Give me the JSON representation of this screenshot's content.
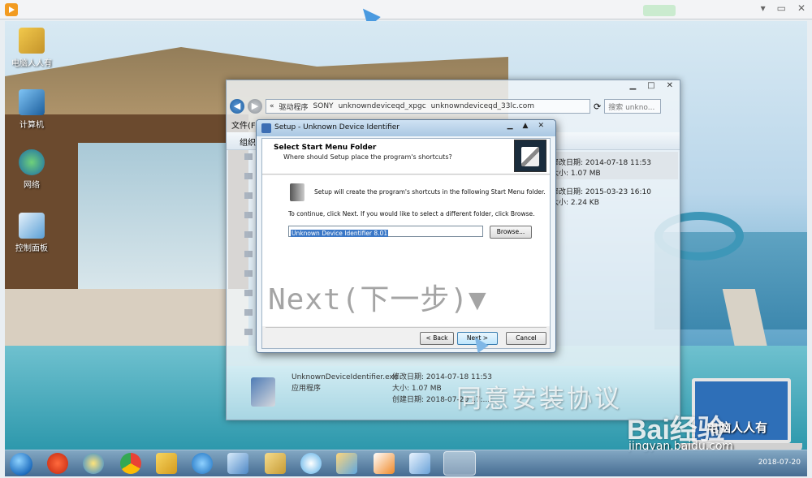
{
  "desktop": {
    "icons": [
      {
        "label": "电脑人人有"
      },
      {
        "label": "计算机"
      },
      {
        "label": "网络"
      },
      {
        "label": "控制面板"
      }
    ]
  },
  "explorer": {
    "window_controls": [
      "▁",
      "□",
      "✕"
    ],
    "breadcrumb": [
      "«",
      "驱动程序",
      "SONY",
      "unknowndeviceqd_xpgc",
      "unknowndeviceqd_33lc.com"
    ],
    "search_placeholder": "搜索 unkno...",
    "menu": [
      "文件(F)"
    ],
    "cmd_label": "组织",
    "rows": [
      {
        "modified": "修改日期: 2014-07-18 11:53",
        "size": "大小: 1.07 MB"
      },
      {
        "modified": "修改日期: 2015-03-23 16:10",
        "size": "大小: 2.24 KB"
      }
    ],
    "status": {
      "filename": "UnknownDeviceIdentifier.exe",
      "modified": "修改日期: 2014-07-18 11:53",
      "type": "应用程序",
      "size": "大小: 1.07 MB",
      "created": "创建日期: 2018-07-20 17:..."
    }
  },
  "wizard": {
    "title": "Setup - Unknown Device Identifier",
    "window_controls": [
      "▁",
      "▲",
      "✕"
    ],
    "heading": "Select Start Menu Folder",
    "subheading": "Where should Setup place the program's shortcuts?",
    "info_text": "Setup will create the program's shortcuts in the following Start Menu folder.",
    "continue_text": "To continue, click Next. If you would like to select a different folder, click Browse.",
    "folder_value": "Unknown Device Identifier 8.01",
    "browse_label": "Browse...",
    "back_label": "< Back",
    "next_label": "Next >",
    "cancel_label": "Cancel"
  },
  "overlays": {
    "next_hint": "Next(下一步)▼",
    "agree_text": "同意安装协议",
    "laptop_text": "电脑人人有",
    "baidu_logo": "Bai经验",
    "baidu_url": "jingyan.baidu.com"
  },
  "taskbar": {
    "items": [
      "start",
      "antivirus",
      "ie",
      "chrome",
      "folder-yellow",
      "browser-blue",
      "network",
      "explorer",
      "pinwheel",
      "paint",
      "media",
      "notes",
      "setup-active"
    ],
    "clock": "2018-07-20"
  },
  "colors": {
    "titlebar": "#cfe2f3",
    "selection": "#3b78c7",
    "taskbar": "#3c648c"
  }
}
